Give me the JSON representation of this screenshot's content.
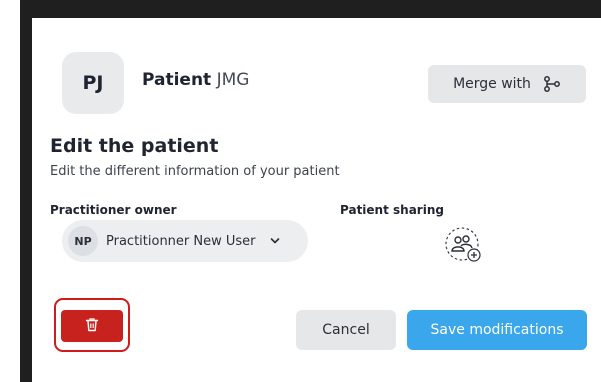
{
  "patient": {
    "initials": "PJ",
    "title_word": "Patient",
    "code": "JMG"
  },
  "header": {
    "merge_label": "Merge with"
  },
  "edit": {
    "title": "Edit the patient",
    "subtitle": "Edit the different information of your patient"
  },
  "owner": {
    "label": "Practitioner owner",
    "initials": "NP",
    "name": "Practitionner New User"
  },
  "sharing": {
    "label": "Patient sharing"
  },
  "footer": {
    "cancel_label": "Cancel",
    "save_label": "Save modifications"
  },
  "colors": {
    "delete": "#c8221f",
    "highlight": "#d11a1a",
    "primary": "#3aa6ec"
  },
  "icons": {
    "merge": "merge-branch-icon",
    "chevron": "chevron-down-icon",
    "sharing": "add-people-icon",
    "delete": "trash-icon"
  }
}
